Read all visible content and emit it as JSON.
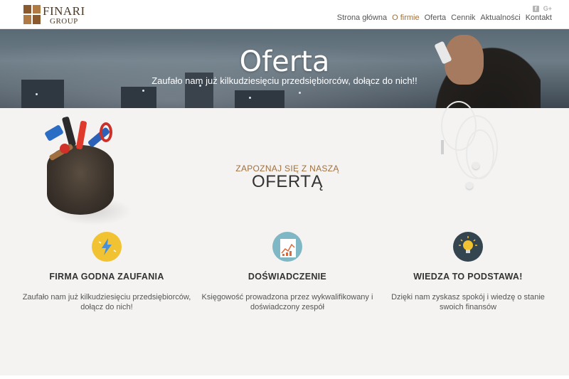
{
  "logo": {
    "line1": "FINARI",
    "line2": "GROUP"
  },
  "social": {
    "facebook": "f",
    "googleplus": "G+"
  },
  "nav": [
    {
      "label": "Strona główna",
      "active": false
    },
    {
      "label": "O firmie",
      "active": true
    },
    {
      "label": "Oferta",
      "active": false
    },
    {
      "label": "Cennik",
      "active": false
    },
    {
      "label": "Aktualności",
      "active": false
    },
    {
      "label": "Kontakt",
      "active": false
    }
  ],
  "hero": {
    "title": "Oferta",
    "subtitle": "Zaufało nam już kilkudziesięciu przedsiębiorców, dołącz do nich!!"
  },
  "intro": {
    "pre": "ZAPOZNAJ SIĘ Z NASZĄ",
    "title": "OFERTĄ"
  },
  "features": [
    {
      "icon": "lightning-icon",
      "title": "FIRMA GODNA ZAUFANIA",
      "text": "Zaufało nam już kilkudziesięciu przedsiębiorców, dołącz do nich!",
      "color": "#f1c232"
    },
    {
      "icon": "chart-icon",
      "title": "DOŚWIADCZENIE",
      "text": "Księgowość prowadzona przez wykwalifikowany i doświadczony zespół",
      "color": "#7fb8c4"
    },
    {
      "icon": "lightbulb-icon",
      "title": "WIEDZA TO PODSTAWA!",
      "text": "Dzięki nam zyskasz spokój i wiedzę o stanie swoich finansów",
      "color": "#354550"
    }
  ],
  "colors": {
    "accent": "#a0703d",
    "section_bg": "#f4f3f1"
  }
}
